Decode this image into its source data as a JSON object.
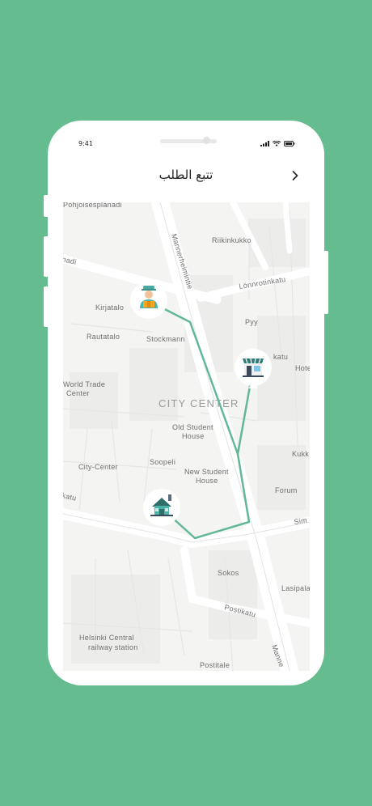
{
  "status_bar": {
    "time": "9:41"
  },
  "header": {
    "title": "تتبع الطلب",
    "back_icon": "chevron-right-icon"
  },
  "map": {
    "labels": {
      "esplanadi": "Pohjoisesplanadi",
      "riikinkukko": "Riikinkukko",
      "nadi": "nadi",
      "lonnrotinkatu": "Lönnrotinkatu",
      "kirjatalo": "Kirjatalo",
      "mannerheimintie": "Mannerheimintie",
      "pyy": "Pyy",
      "rautatalo": "Rautatalo",
      "stockmann": "Stockmann",
      "katu": "katu",
      "hote": "Hote",
      "world_trade": "World Trade",
      "center": "Center",
      "city_center": "CITY CENTER",
      "old_student": "Old Student",
      "house1": "House",
      "kukk": "Kukk",
      "city_center_small": "City-Center",
      "soopeli": "Soopeli",
      "new_student": "New Student",
      "house2": "House",
      "forum": "Forum",
      "katu_left": "katu",
      "sim": "Sim",
      "sokos": "Sokos",
      "lasipala": "Lasipala",
      "postikatu": "Postikatu",
      "helsinki_central": "Helsinki Central",
      "railway_station": "railway station",
      "postitalo": "Postitale",
      "manne_bottom": "Manne"
    },
    "markers": {
      "courier": "courier-icon",
      "store": "store-icon",
      "home": "home-icon"
    },
    "route_color": "#62b896"
  }
}
